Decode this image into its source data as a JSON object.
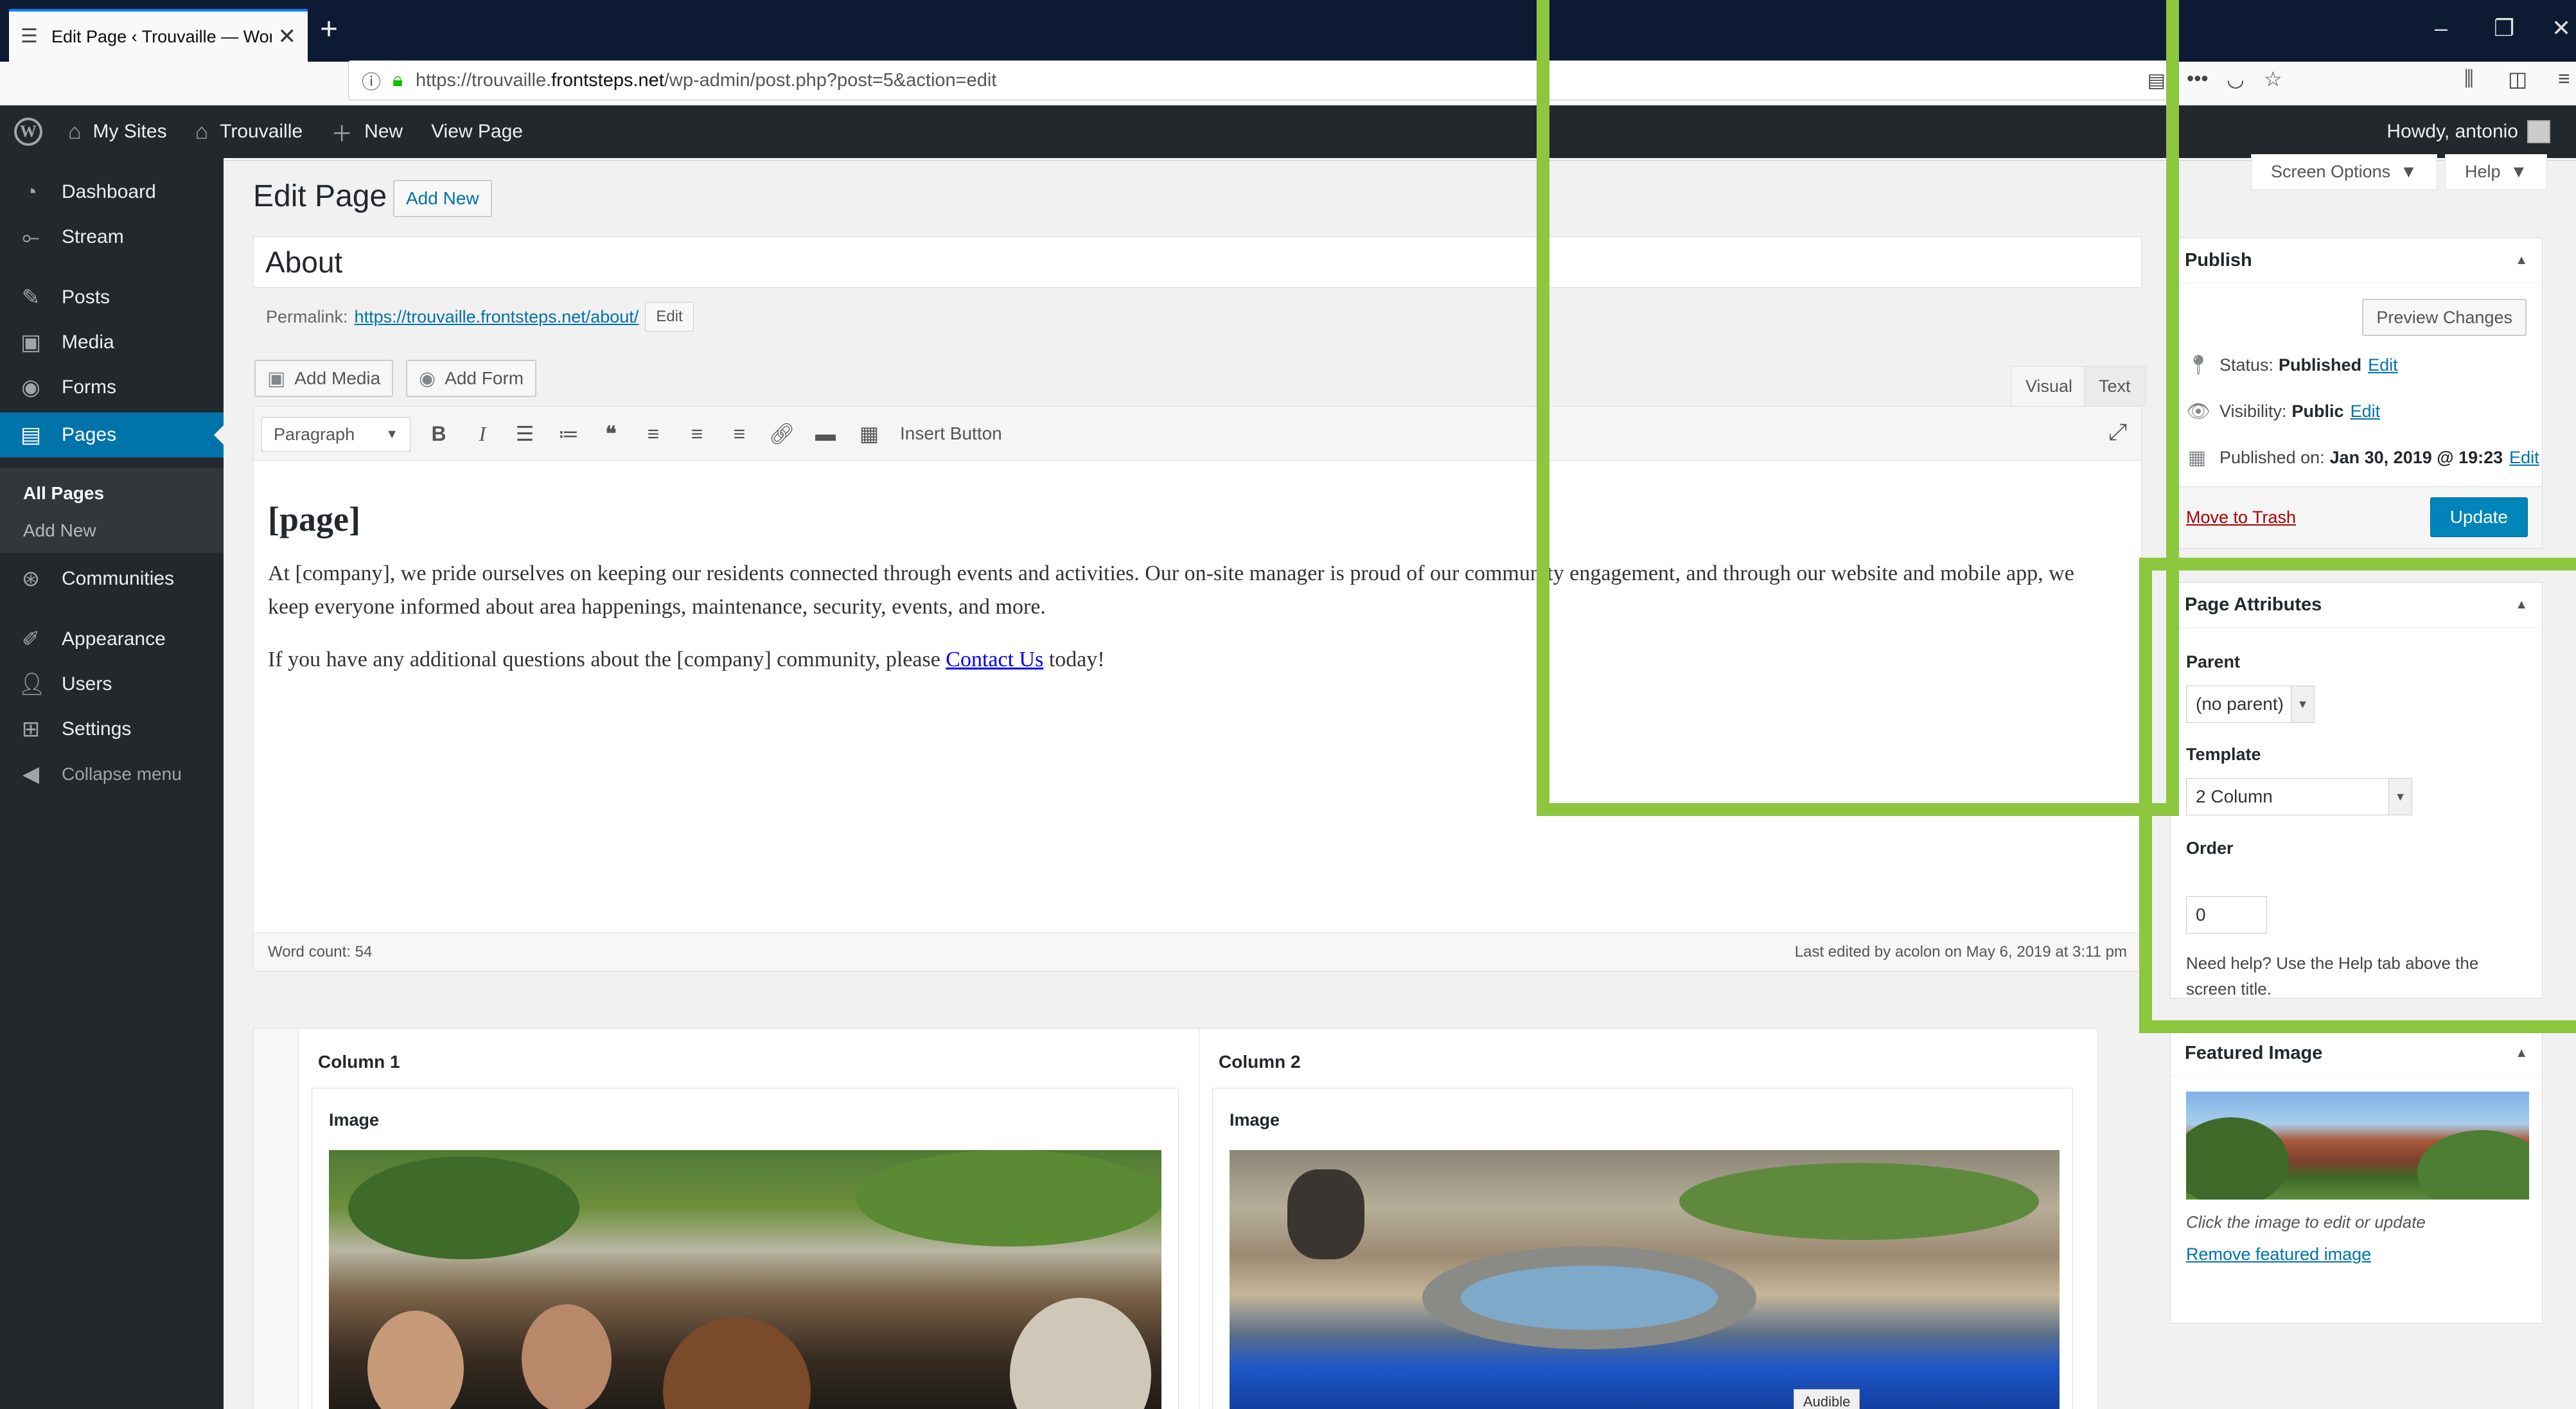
{
  "browser": {
    "tab_title": "Edit Page ‹ Trouvaille — WordP",
    "url_prefix": "https://trouvaille.",
    "url_domain": "frontsteps.net",
    "url_path": "/wp-admin/post.php?post=5&action=edit",
    "icons": [
      "back-icon",
      "forward-icon",
      "reload-icon",
      "home-icon",
      "info-icon",
      "lock-icon",
      "reader-icon",
      "more-icon",
      "pocket-icon",
      "star-icon",
      "library-icon",
      "sidebar-icon",
      "menu-icon"
    ]
  },
  "adminbar": {
    "my_sites": "My Sites",
    "site": "Trouvaille",
    "new": "New",
    "view_page": "View Page",
    "howdy": "Howdy, antonio"
  },
  "sidebar": {
    "items": [
      {
        "label": "Dashboard"
      },
      {
        "label": "Stream"
      },
      {
        "label": "Posts"
      },
      {
        "label": "Media"
      },
      {
        "label": "Forms"
      },
      {
        "label": "Pages"
      },
      {
        "label": "Communities"
      },
      {
        "label": "Appearance"
      },
      {
        "label": "Users"
      },
      {
        "label": "Settings"
      },
      {
        "label": "Collapse menu"
      }
    ],
    "submenu": [
      {
        "label": "All Pages"
      },
      {
        "label": "Add New"
      }
    ]
  },
  "screen_options": "Screen Options",
  "help": "Help",
  "heading": "Edit Page",
  "add_new": "Add New",
  "post_title": "About",
  "permalink": {
    "label": "Permalink:",
    "url": "https://trouvaille.frontsteps.net/about/",
    "edit": "Edit"
  },
  "add_media": "Add Media",
  "add_form": "Add Form",
  "editor_tabs": {
    "visual": "Visual",
    "text": "Text"
  },
  "toolbar": {
    "format": "Paragraph",
    "insert_button": "Insert Button"
  },
  "content": {
    "heading": "[page]",
    "para1": "At [company], we pride ourselves on keeping our residents connected through events and activities. Our on-site manager is proud of our community engagement, and through our website and mobile app, we keep everyone informed about area happenings, maintenance, security, events, and more.",
    "para2_before": "If you have any additional questions about the [company] community, please ",
    "para2_link": "Contact Us",
    "para2_after": " today!"
  },
  "status": {
    "word_count": "Word count: 54",
    "last_edited": "Last edited by acolon on May 6, 2019 at 3:11 pm"
  },
  "builder": {
    "col1": "Column 1",
    "col2": "Column 2",
    "module": "Image"
  },
  "audible": "Audible",
  "publish": {
    "title": "Publish",
    "preview": "Preview Changes",
    "status_label": "Status:",
    "status_value": "Published",
    "visibility_label": "Visibility:",
    "visibility_value": "Public",
    "published_on_label": "Published on:",
    "published_on_value": "Jan 30, 2019 @ 19:23",
    "edit": "Edit",
    "trash": "Move to Trash",
    "update": "Update"
  },
  "page_attributes": {
    "title": "Page Attributes",
    "parent_label": "Parent",
    "parent_value": "(no parent)",
    "template_label": "Template",
    "template_value": "2 Column",
    "order_label": "Order",
    "order_value": "0",
    "help": "Need help? Use the Help tab above the screen title."
  },
  "featured_image": {
    "title": "Featured Image",
    "caption": "Click the image to edit or update",
    "remove": "Remove featured image"
  },
  "colors": {
    "highlight": "#8dc63f",
    "wp_blue": "#0073aa",
    "admin_dark": "#23282d"
  }
}
